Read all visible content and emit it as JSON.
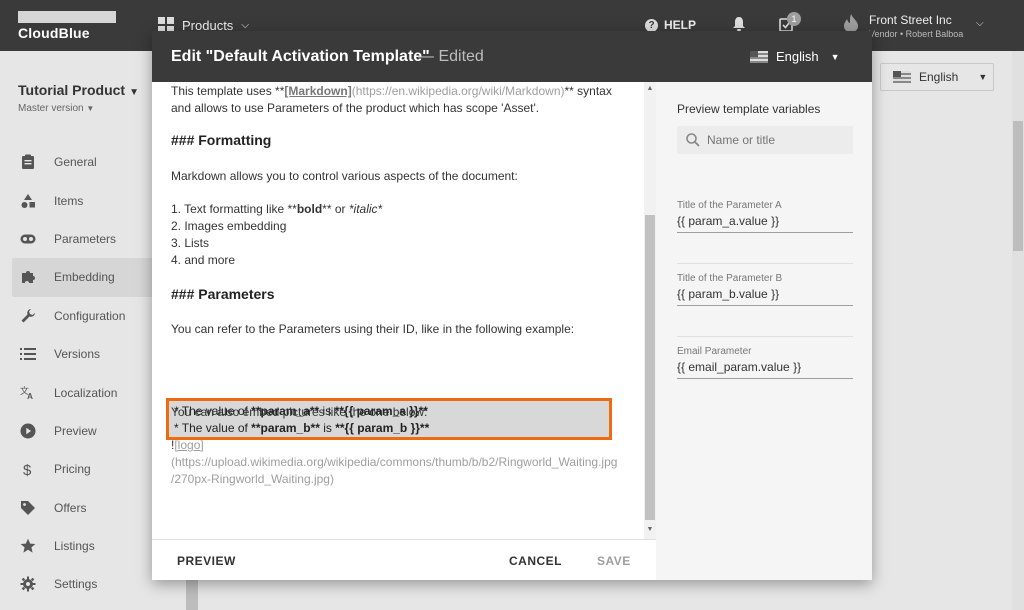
{
  "topbar": {
    "logo": "CloudBlue",
    "products": "Products",
    "help": "HELP",
    "tasks_badge": "1",
    "account_name": "Front Street Inc",
    "account_role": "Vendor • Robert Balboa"
  },
  "sidebar": {
    "product_title": "Tutorial Product",
    "product_version": "Master version",
    "items": [
      {
        "label": "General",
        "icon": "clipboard-icon"
      },
      {
        "label": "Items",
        "icon": "shapes-icon"
      },
      {
        "label": "Parameters",
        "icon": "parameters-icon"
      },
      {
        "label": "Embedding",
        "icon": "puzzle-icon"
      },
      {
        "label": "Configuration",
        "icon": "wrench-icon"
      },
      {
        "label": "Versions",
        "icon": "list-icon"
      },
      {
        "label": "Localization",
        "icon": "translate-icon"
      },
      {
        "label": "Preview",
        "icon": "play-icon"
      },
      {
        "label": "Pricing",
        "icon": "dollar-icon"
      },
      {
        "label": "Offers",
        "icon": "tag-icon"
      },
      {
        "label": "Listings",
        "icon": "star-icon"
      },
      {
        "label": "Settings",
        "icon": "gear-icon"
      }
    ],
    "active_index": 3
  },
  "background": {
    "language": "English"
  },
  "modal": {
    "title": "Edit \"Default Activation Template\"",
    "edited": "— Edited",
    "language": "English",
    "editor": {
      "l1_pre": "This template uses **",
      "l1_link": "[Markdown]",
      "l1_url": "(https://en.wikipedia.org/wiki/Markdown)",
      "l1_post": "** syntax",
      "l2": "and allows to use Parameters of the product which has scope 'Asset'.",
      "h1": "### Formatting",
      "p1": "Markdown allows you to control various aspects of the document:",
      "li1_pre": "1. Text formatting like **",
      "li1_bold": "bold",
      "li1_mid": "** or ",
      "li1_italic": "*italic*",
      "li2": "2. Images embedding",
      "li3": "3. Lists",
      "li4": "4. and more",
      "h2": "### Parameters",
      "p2": "You can refer to the Parameters using their ID, like in the following example:",
      "hl1_a": "* The value of ",
      "hl1_b": "**param_a**",
      "hl1_c": " is ",
      "hl1_d": "**{{ param_a }}**",
      "hl2_a": "* The value of ",
      "hl2_b": "**param_b**",
      "hl2_c": " is ",
      "hl2_d": "**{{ param_b }}**",
      "p3": "You can also embed pictures like the one below:",
      "img_pre": "!",
      "img_link": "[logo]",
      "img_url1": "(https://upload.wikimedia.org/wikipedia/commons/thumb/b/b2/Ringworld_Waiting.jpg",
      "img_url2": "/270px-Ringworld_Waiting.jpg)"
    },
    "footer": {
      "preview": "PREVIEW",
      "cancel": "CANCEL",
      "save": "SAVE"
    },
    "variables": {
      "title": "Preview template variables",
      "search_placeholder": "Name or title",
      "fields": [
        {
          "label": "Title of the Parameter A",
          "value": "{{ param_a.value }}"
        },
        {
          "label": "Title of the Parameter B",
          "value": "{{ param_b.value }}"
        },
        {
          "label": "Email Parameter",
          "value": "{{ email_param.value }}"
        }
      ]
    }
  }
}
